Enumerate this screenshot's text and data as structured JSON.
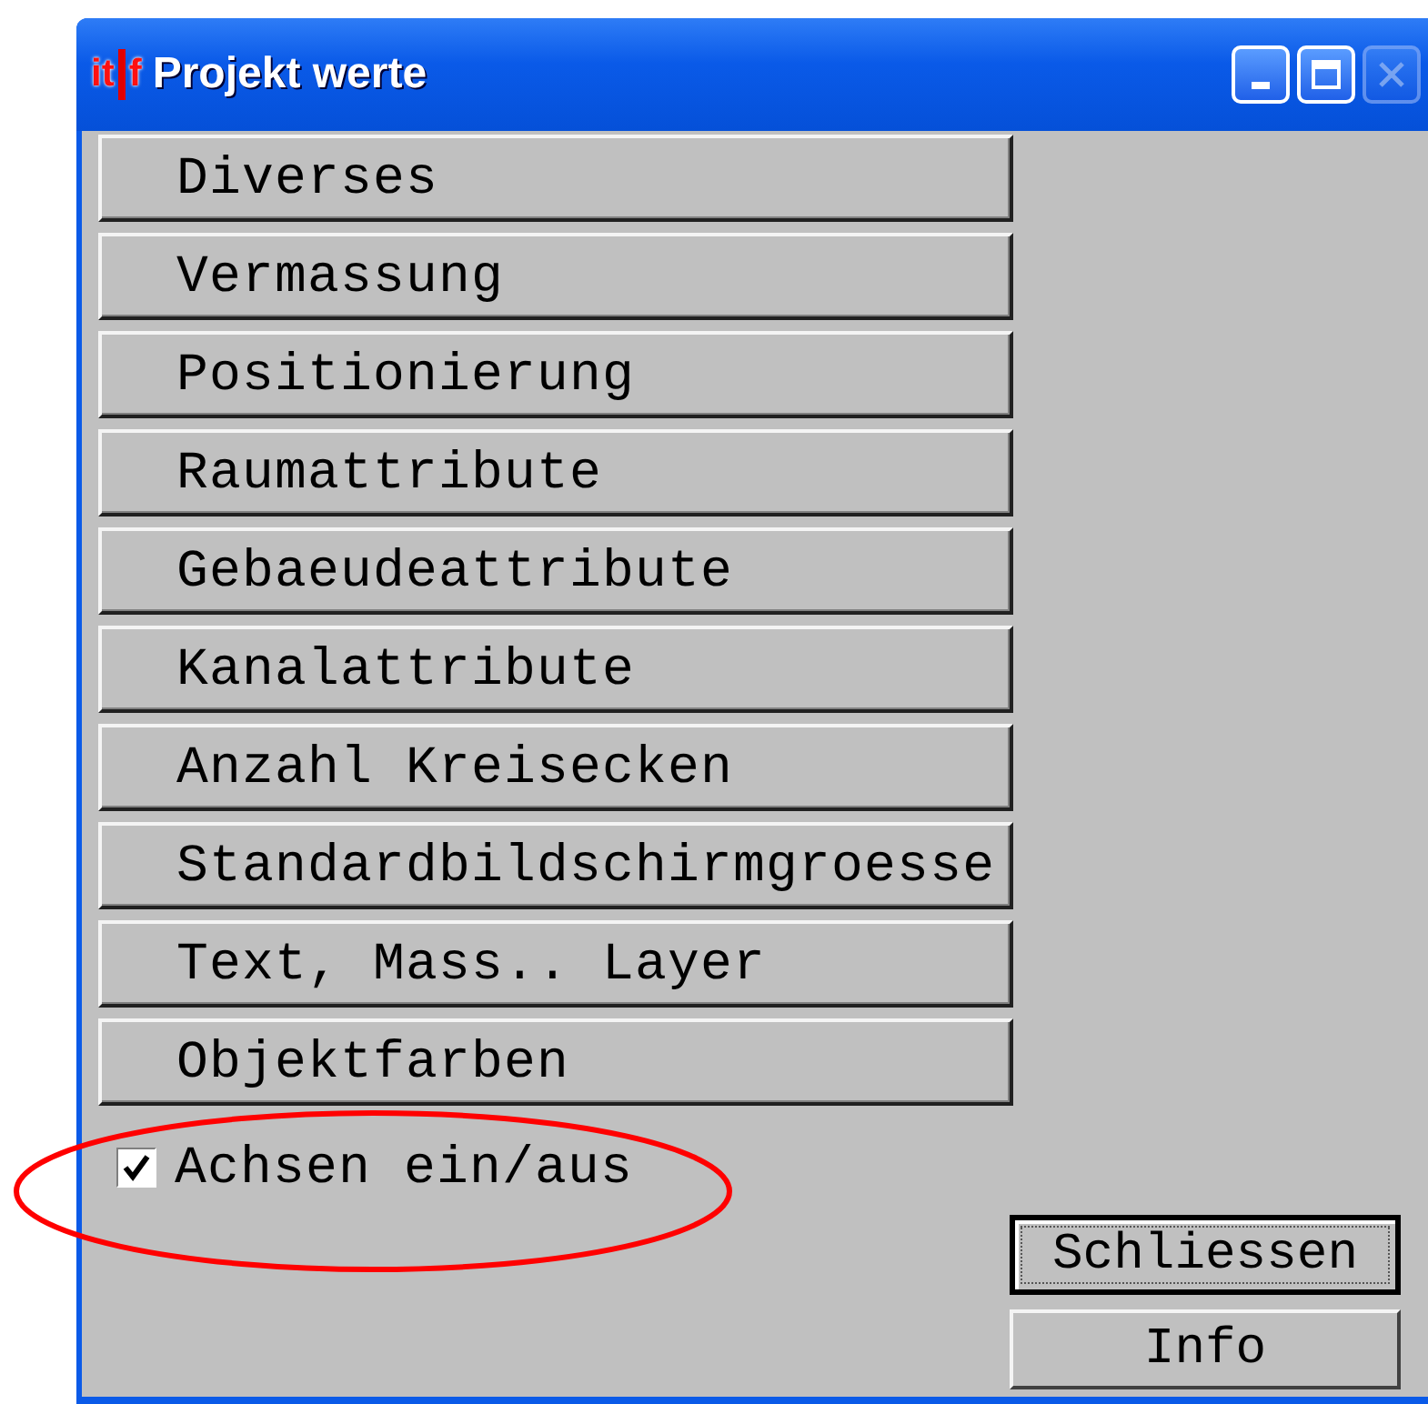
{
  "window": {
    "title": "Projekt werte",
    "icon": {
      "left": "it",
      "right": "f"
    },
    "close_enabled": false
  },
  "menu_buttons": [
    {
      "label": "Diverses"
    },
    {
      "label": "Vermassung"
    },
    {
      "label": "Positionierung"
    },
    {
      "label": "Raumattribute"
    },
    {
      "label": "Gebaeudeattribute"
    },
    {
      "label": "Kanalattribute"
    },
    {
      "label": "Anzahl Kreisecken"
    },
    {
      "label": "Standardbildschirmgroesse"
    },
    {
      "label": "Text, Mass.. Layer"
    },
    {
      "label": "Objektfarben"
    }
  ],
  "checkbox": {
    "label": "Achsen ein/aus",
    "checked": true
  },
  "buttons": [
    {
      "label": "Schliessen",
      "focused": true
    },
    {
      "label": "Info",
      "focused": false
    }
  ],
  "annotation": {
    "kind": "ellipse"
  }
}
